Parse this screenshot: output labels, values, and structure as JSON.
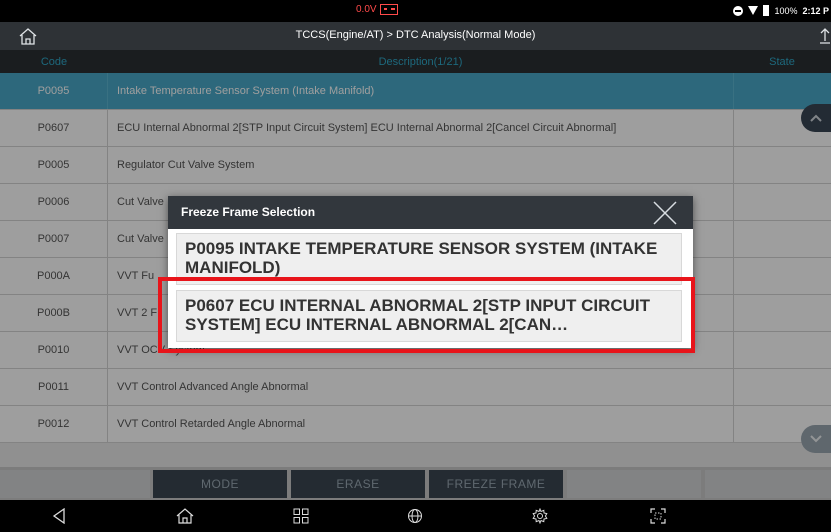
{
  "status_bar": {
    "voltage": "0.0V",
    "battery_percent": "100%",
    "time": "2:12 P"
  },
  "title_bar": {
    "title": "TCCS(Engine/AT) > DTC Analysis(Normal Mode)"
  },
  "table": {
    "headers": {
      "code": "Code",
      "description": "Description(1/21)",
      "state": "State"
    },
    "rows": [
      {
        "code": "P0095",
        "description": "Intake Temperature Sensor System (Intake Manifold)",
        "state": ""
      },
      {
        "code": "P0607",
        "description": "ECU Internal Abnormal 2[STP Input Circuit System] ECU Internal Abnormal 2[Cancel Circuit Abnormal]",
        "state": ""
      },
      {
        "code": "P0005",
        "description": "Regulator Cut Valve System",
        "state": ""
      },
      {
        "code": "P0006",
        "description": "Cut Valve",
        "state": ""
      },
      {
        "code": "P0007",
        "description": "Cut Valve",
        "state": ""
      },
      {
        "code": "P000A",
        "description": "VVT Fu",
        "state": ""
      },
      {
        "code": "P000B",
        "description": "VVT 2 F",
        "state": ""
      },
      {
        "code": "P0010",
        "description": "VVT OCV System",
        "state": ""
      },
      {
        "code": "P0011",
        "description": "VVT Control Advanced Angle Abnormal",
        "state": ""
      },
      {
        "code": "P0012",
        "description": "VVT Control Retarded Angle Abnormal",
        "state": ""
      }
    ],
    "selected_row_index": 0
  },
  "function_buttons": {
    "mode": "MODE",
    "erase": "ERASE",
    "freeze_frame": "FREEZE FRAME"
  },
  "dialog": {
    "title": "Freeze Frame Selection",
    "items": [
      {
        "text": "P0095 INTAKE TEMPERATURE SENSOR SYSTEM (INTAKE MANIFOLD)"
      },
      {
        "text": "P0607 ECU INTERNAL ABNORMAL 2[STP INPUT CIRCUIT SYSTEM] ECU INTERNAL ABNORMAL 2[CAN…"
      }
    ],
    "highlighted_item_index": 1
  },
  "colors": {
    "selected_row": "#4aa9c8",
    "header_text": "#2fa8c8",
    "highlight_box": "#e8141a",
    "dark_bar": "#2e3236"
  },
  "icons": {
    "home": "home-icon",
    "share": "share-icon",
    "close": "close-icon",
    "scroll_up": "chevron-up-icon",
    "scroll_down": "chevron-down-icon",
    "nav_back": "back-icon",
    "nav_home": "home-icon",
    "nav_apps": "grid-icon",
    "nav_web": "globe-icon",
    "nav_settings": "gear-icon",
    "nav_capture": "screenshot-icon"
  }
}
